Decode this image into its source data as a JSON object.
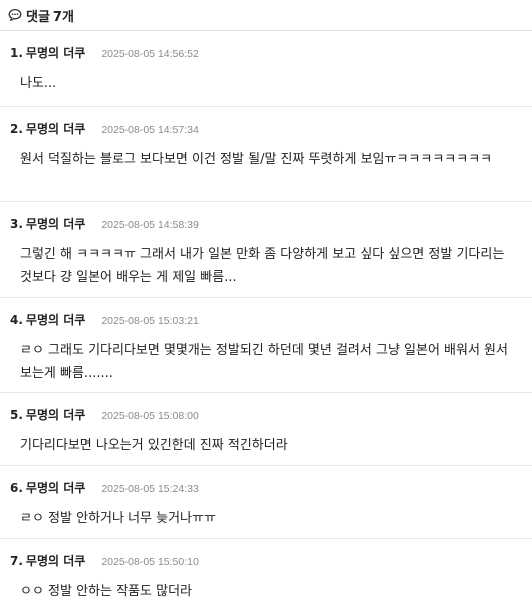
{
  "header": {
    "label": "댓글",
    "count": "7개",
    "icon": "speech-bubble-icon"
  },
  "comments": [
    {
      "num": "1.",
      "author": "무명의 더쿠",
      "time": "2025-08-05 14:56:52",
      "body": "나도..."
    },
    {
      "num": "2.",
      "author": "무명의 더쿠",
      "time": "2025-08-05 14:57:34",
      "body": "원서 덕질하는 블로그 보다보면 이건 정발 될/말 진짜 뚜렷하게 보임ㅠㅋㅋㅋㅋㅋㅋㅋㅋ"
    },
    {
      "num": "3.",
      "author": "무명의 더쿠",
      "time": "2025-08-05 14:58:39",
      "body": "그렇긴 해 ㅋㅋㅋㅋㅠ 그래서 내가 일본 만화 좀 다양하게 보고 싶다 싶으면 정발 기다리는 것보다 걍 일본어 배우는 게 제일 빠름..."
    },
    {
      "num": "4.",
      "author": "무명의 더쿠",
      "time": "2025-08-05 15:03:21",
      "body": "ㄹㅇ 그래도 기다리다보면 몇몇개는 정발되긴 하던데 몇년 걸려서 그냥 일본어 배워서 원서보는게 빠름......."
    },
    {
      "num": "5.",
      "author": "무명의 더쿠",
      "time": "2025-08-05 15:08:00",
      "body": "기다리다보면 나오는거 있긴한데 진짜 적긴하더라"
    },
    {
      "num": "6.",
      "author": "무명의 더쿠",
      "time": "2025-08-05 15:24:33",
      "body": "ㄹㅇ 정발 안하거나 너무 늦거나ㅠㅠ"
    },
    {
      "num": "7.",
      "author": "무명의 더쿠",
      "time": "2025-08-05 15:50:10",
      "body": "ㅇㅇ 정발 안하는 작품도 많더라"
    }
  ]
}
